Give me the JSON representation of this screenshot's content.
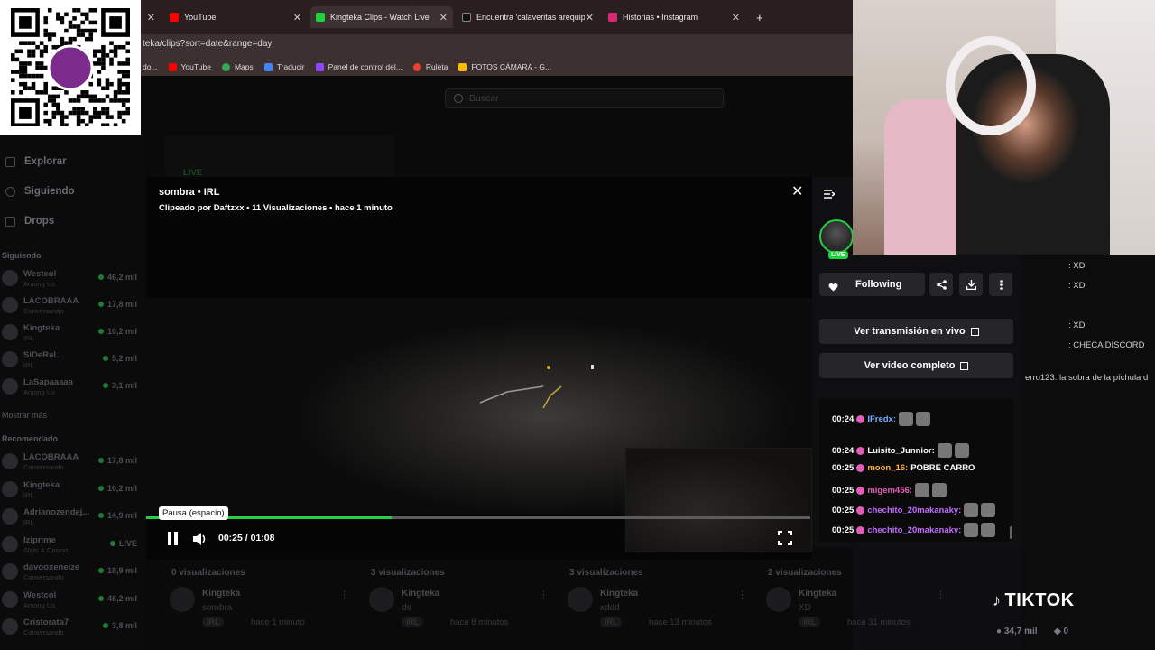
{
  "browser": {
    "tabs": [
      {
        "title": "",
        "active": false
      },
      {
        "title": "YouTube",
        "active": false
      },
      {
        "title": "Kingteka Clips - Watch Live",
        "active": true
      },
      {
        "title": "Encuentra 'calaveritas arequipa",
        "active": false
      },
      {
        "title": "Historias • Instagram",
        "active": false
      }
    ],
    "new_tab": "+",
    "url": "teka/clips?sort=date&range=day",
    "bookmarks": [
      "do...",
      "YouTube",
      "Maps",
      "Traducir",
      "Panel de control del...",
      "Ruleta",
      "FOTOS CÁMARA - G..."
    ]
  },
  "search": {
    "placeholder": "Buscar"
  },
  "sidebar": {
    "nav": [
      "Explorar",
      "Siguiendo",
      "Drops"
    ],
    "following_title": "Siguiendo",
    "following": [
      {
        "name": "Westcol",
        "category": "Among Us",
        "viewers": "46,2 mil"
      },
      {
        "name": "LACOBRAAA",
        "category": "Conversando",
        "viewers": "17,8 mil"
      },
      {
        "name": "Kingteka",
        "category": "IRL",
        "viewers": "10,2 mil"
      },
      {
        "name": "SiDeRaL",
        "category": "IRL",
        "viewers": "5,2 mil"
      },
      {
        "name": "LaSapaaaaa",
        "category": "Among Us",
        "viewers": "3,1 mil"
      }
    ],
    "show_more": "Mostrar más",
    "recommended_title": "Recomendado",
    "recommended": [
      {
        "name": "LACOBRAAA",
        "category": "Conversando",
        "viewers": "17,8 mil"
      },
      {
        "name": "Kingteka",
        "category": "IRL",
        "viewers": "10,2 mil"
      },
      {
        "name": "Adrianozendej...",
        "category": "IRL",
        "viewers": "14,9 mil"
      },
      {
        "name": "Iziprime",
        "category": "Slots & Casino",
        "viewers": "LIVE"
      },
      {
        "name": "davooxeneize",
        "category": "Conversando",
        "viewers": "18,9 mil"
      },
      {
        "name": "Westcol",
        "category": "Among Us",
        "viewers": "46,2 mil"
      },
      {
        "name": "Cristorata7",
        "category": "Conversando",
        "viewers": "3,8 mil"
      }
    ]
  },
  "background": {
    "live_label": "LIVE"
  },
  "player": {
    "title": "sombra • IRL",
    "meta": "Clipeado por Daftzxx • 11 Visualizaciones • hace 1 minuto",
    "tooltip": "Pausa (espacio)",
    "time": "00:25 / 01:08",
    "progress": 0.37
  },
  "panel": {
    "live_badge": "LIVE",
    "following_label": "Following",
    "watch_live": "Ver transmisión en vivo",
    "watch_vod": "Ver video completo"
  },
  "chat": [
    {
      "time": "00:24",
      "user": "IFredx:",
      "text": "",
      "color": "#6fb0ff"
    },
    {
      "time": "00:24",
      "user": "Luisito_Junnior:",
      "text": "",
      "color": "#ffffff"
    },
    {
      "time": "00:25",
      "user": "moon_16:",
      "text": "POBRE CARRO",
      "color": "#ffb13b"
    },
    {
      "time": "00:25",
      "user": "migem456:",
      "text": "",
      "color": "#e05eb8"
    },
    {
      "time": "00:25",
      "user": "chechito_20makanaky:",
      "text": "",
      "color": "#c36bff"
    },
    {
      "time": "00:25",
      "user": "chechito_20makanaky:",
      "text": "",
      "color": "#c36bff"
    }
  ],
  "cards": [
    {
      "views": "0 visualizaciones",
      "channel": "Kingteka",
      "title": "sombra",
      "tag": "IRL",
      "ago": "hace 1 minuto"
    },
    {
      "views": "3 visualizaciones",
      "channel": "Kingteka",
      "title": "ds",
      "tag": "IRL",
      "ago": "hace 8 minutos"
    },
    {
      "views": "3 visualizaciones",
      "channel": "Kingteka",
      "title": "xddd",
      "tag": "IRL",
      "ago": "hace 13 minutos"
    },
    {
      "views": "2 visualizaciones",
      "channel": "Kingteka",
      "title": "XD",
      "tag": "IRL",
      "ago": "hace 31 minutos"
    }
  ],
  "right_chat": [
    {
      "text": ": XD"
    },
    {
      "text": ": XD"
    },
    {
      "text": ": XD"
    },
    {
      "text": ": CHECA DISCORD"
    },
    {
      "text": "erro123: la sobra de la píchula d"
    }
  ],
  "overlay": {
    "tiktok": "TIKTOK",
    "viewers": "34,7 mil",
    "zero": "0"
  }
}
